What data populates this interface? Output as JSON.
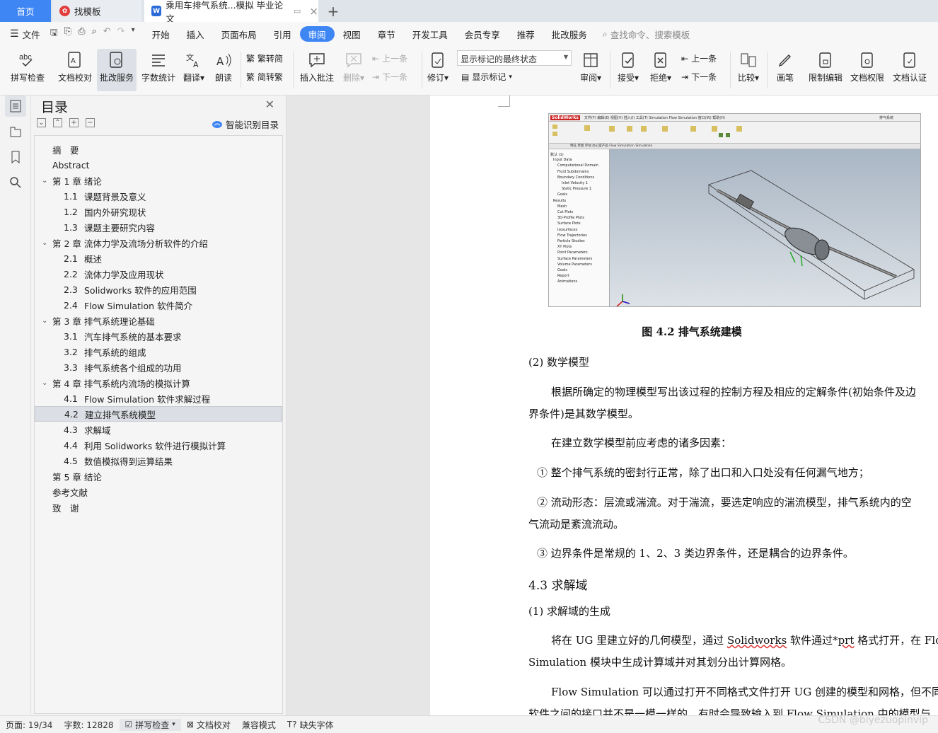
{
  "tabs": {
    "home": "首页",
    "template": "找模板",
    "document": "乘用车排气系统...模拟 毕业论文",
    "add": "+",
    "close": "×"
  },
  "menu": {
    "file": "文件",
    "items": [
      "开始",
      "插入",
      "页面布局",
      "引用",
      "审阅",
      "视图",
      "章节",
      "开发工具",
      "会员专享",
      "推荐",
      "批改服务"
    ],
    "active_index": 4,
    "search_placeholder": "查找命令、搜索模板"
  },
  "ribbon": {
    "spell": "拼写检查",
    "proof": "文档校对",
    "correct_service": "批改服务",
    "word_count": "字数统计",
    "translate": "翻译",
    "read_aloud": "朗读",
    "to_traditional": "繁转简",
    "to_simplified": "简转繁",
    "insert_comment": "插入批注",
    "delete": "删除",
    "prev_comment": "上一条",
    "next_comment": "下一条",
    "track_changes": "修订",
    "markup_state": "显示标记的最终状态",
    "show_markup": "显示标记",
    "review": "审阅",
    "accept": "接受",
    "reject": "拒绝",
    "prev_change": "上一条",
    "next_change": "下一条",
    "compare": "比较",
    "ink": "画笔",
    "restrict_edit": "限制编辑",
    "doc_permission": "文档权限",
    "doc_cert": "文档认证"
  },
  "toc": {
    "title": "目录",
    "smart_detect": "智能识别目录",
    "items": [
      {
        "num": "",
        "text": "摘　要",
        "level": 0
      },
      {
        "num": "",
        "text": "Abstract",
        "level": 0
      },
      {
        "num": "",
        "text": "第 1 章  绪论",
        "level": 0,
        "expand": true
      },
      {
        "num": "1.1",
        "text": "课题背景及意义",
        "level": 1
      },
      {
        "num": "1.2",
        "text": "国内外研究现状",
        "level": 1
      },
      {
        "num": "1.3",
        "text": "课题主要研究内容",
        "level": 1
      },
      {
        "num": "",
        "text": "第 2 章  流体力学及流场分析软件的介绍",
        "level": 0,
        "expand": true
      },
      {
        "num": "2.1",
        "text": "概述",
        "level": 1
      },
      {
        "num": "2.2",
        "text": "流体力学及应用现状",
        "level": 1
      },
      {
        "num": "2.3",
        "text": "Solidworks 软件的应用范围",
        "level": 1
      },
      {
        "num": "2.4",
        "text": "Flow Simulation  软件简介",
        "level": 1
      },
      {
        "num": "",
        "text": "第 3 章  排气系统理论基础",
        "level": 0,
        "expand": true
      },
      {
        "num": "3.1",
        "text": "汽车排气系统的基本要求",
        "level": 1
      },
      {
        "num": "3.2",
        "text": "排气系统的组成",
        "level": 1
      },
      {
        "num": "3.3",
        "text": "排气系统各个组成的功用",
        "level": 1
      },
      {
        "num": "",
        "text": "第 4 章  排气系统内流场的模拟计算",
        "level": 0,
        "expand": true
      },
      {
        "num": "4.1",
        "text": "Flow Simulation 软件求解过程",
        "level": 1
      },
      {
        "num": "4.2",
        "text": "建立排气系统模型",
        "level": 1,
        "selected": true
      },
      {
        "num": "4.3",
        "text": "求解域",
        "level": 1
      },
      {
        "num": "4.4",
        "text": "利用 Solidworks 软件进行模拟计算",
        "level": 1
      },
      {
        "num": "4.5",
        "text": "数值模拟得到运算结果",
        "level": 1
      },
      {
        "num": "",
        "text": "第 5 章  结论",
        "level": 0
      },
      {
        "num": "",
        "text": "参考文献",
        "level": 0
      },
      {
        "num": "",
        "text": "致　谢",
        "level": 0
      }
    ]
  },
  "solidworks": {
    "logo": "SolidWorks",
    "menu": "文件(F)  编辑(E)  视图(V)  插入(I)  工具(T)  Simulation  Flow Simulation  窗口(W)  帮助(H)",
    "title_right": "排气系统",
    "tabs": "特征  草图  评估  办公室产品  Flow Simulation  Simulation",
    "tree": [
      "默认 (1)",
      "Input Data",
      "Computational Domain",
      "Fluid Subdomains",
      "Boundary Conditions",
      "Inlet Velocity 1",
      "Static Pressure 1",
      "Goals",
      "Results",
      "Mesh",
      "Cut Plots",
      "3D-Profile Plots",
      "Surface Plots",
      "Isosurfaces",
      "Flow Trajectories",
      "Particle Studies",
      "XY Plots",
      "Point Parameters",
      "Surface Parameters",
      "Volume Parameters",
      "Goals",
      "Report",
      "Animations"
    ]
  },
  "doc": {
    "figure_caption": "图 4.2  排气系统建模",
    "math_model_title": "(2)  数学模型",
    "para1_line1": "根据所确定的物理模型写出该过程的控制方程及相应的定解条件(初始条件及边",
    "para1_line2": "界条件)是其数学模型。",
    "para2": "在建立数学模型前应考虑的诸多因素：",
    "item1": "①  整个排气系统的密封行正常，除了出口和入口处没有任何漏气地方；",
    "item2_line1": "②  流动形态：层流或湍流。对于湍流，要选定响应的湍流模型，排气系统内的空",
    "item2_line2": "气流动是紊流流动。",
    "item3": "③  边界条件是常规的 1、2、3 类边界条件，还是耦合的边界条件。",
    "section": "4.3    求解域",
    "sub1": "(1)  求解域的生成",
    "para3_a": "将在 UG 里建立好的几何模型，通过 ",
    "para3_b": "Solidworks",
    "para3_c": " 软件通过*",
    "para3_d": "prt",
    "para3_e": " 格式打开，在 Flow",
    "para3_line2": "Simulation 模块中生成计算域并对其划分出计算网格。",
    "para4_line1": "Flow Simulation 可以通过打开不同格式文件打开 UG 创建的模型和网格，但不同",
    "para4_line2": "软件之间的接口并不是一模一样的，有时会导致输入到 Flow Simulation 中的模型与"
  },
  "status": {
    "page": "页面: 19/34",
    "words": "字数: 12828",
    "spell": "拼写检查",
    "proof": "文档校对",
    "compat": "兼容模式",
    "missing_font": "缺失字体"
  },
  "watermark": "CSDN @biyezuopinvip",
  "colors": {
    "accent": "#3f86f5",
    "selected": "#dbdee4"
  }
}
